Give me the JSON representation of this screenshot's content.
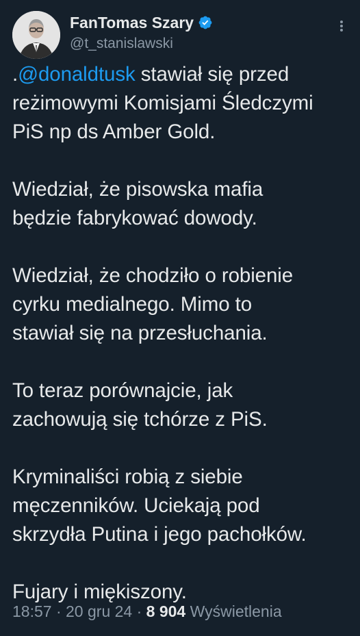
{
  "author": {
    "display_name": "FanTomas Szary",
    "handle": "@t_stanislawski",
    "verified": true,
    "avatar_icon": "profile-photo-icon",
    "more_icon": "more-options-icon"
  },
  "tweet": {
    "prefix": ".",
    "mention": "@donaldtusk",
    "paragraphs": [
      {
        "lines": [
          " stawiał się przed",
          "reżimowymi Komisjami Śledczymi",
          "PiS np ds Amber Gold."
        ]
      },
      {
        "lines": [
          "Wiedział, że pisowska mafia",
          "będzie fabrykować dowody."
        ]
      },
      {
        "lines": [
          "Wiedział, że chodziło o robienie",
          "cyrku medialnego. Mimo to",
          "stawiał się na przesłuchania."
        ]
      },
      {
        "lines": [
          "To teraz porównajcie, jak",
          "zachowują się tchórze z PiS."
        ]
      },
      {
        "lines": [
          "Kryminaliści robią z siebie",
          "męczenników.  Uciekają pod",
          "skrzydła Putina i jego pachołków."
        ]
      },
      {
        "lines": [
          "Fujary i miękiszony."
        ]
      }
    ]
  },
  "meta": {
    "time": "18:57",
    "separator": " · ",
    "date": "20 gru 24",
    "views_count": "8 904",
    "views_label": " Wyświetlenia"
  },
  "colors": {
    "background": "#15202b",
    "text": "#e7e9ea",
    "secondary": "#8b98a5",
    "accent": "#1d9bf0"
  }
}
